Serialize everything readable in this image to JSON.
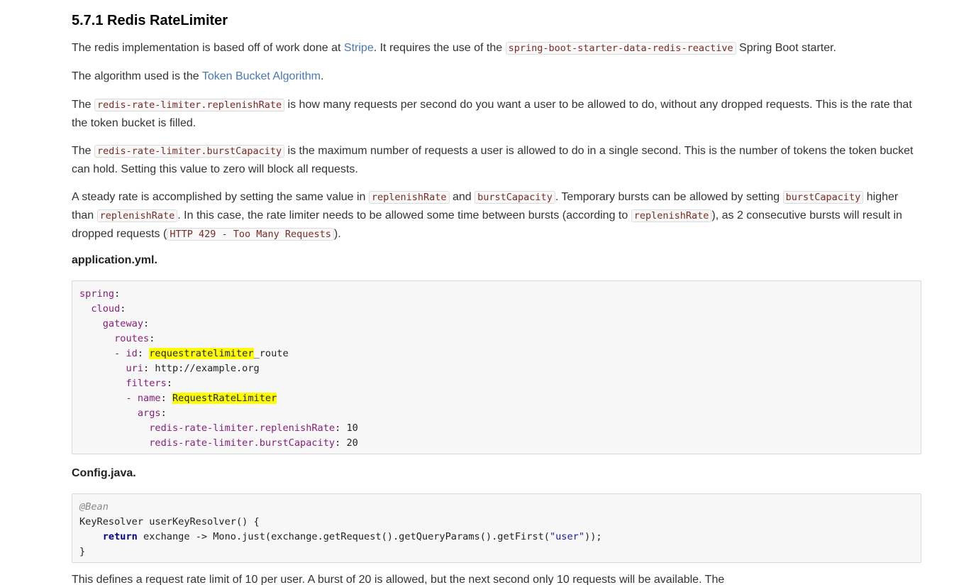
{
  "heading": "5.7.1 Redis RateLimiter",
  "p1": {
    "t1": "The redis implementation is based off of work done at ",
    "link": "Stripe",
    "t2": ". It requires the use of the ",
    "code": "spring-boot-starter-data-redis-reactive",
    "t3": " Spring Boot starter."
  },
  "p2": {
    "t1": "The algorithm used is the ",
    "link": "Token Bucket Algorithm",
    "t2": "."
  },
  "p3": {
    "t1": "The ",
    "code": "redis-rate-limiter.replenishRate",
    "t2": " is how many requests per second do you want a user to be allowed to do, without any dropped requests. This is the rate that the token bucket is filled."
  },
  "p4": {
    "t1": "The ",
    "code": "redis-rate-limiter.burstCapacity",
    "t2": " is the maximum number of requests a user is allowed to do in a single second. This is the number of tokens the token bucket can hold. Setting this value to zero will block all requests."
  },
  "p5": {
    "t1": "A steady rate is accomplished by setting the same value in ",
    "code1": "replenishRate",
    "t2": " and ",
    "code2": "burstCapacity",
    "t3": ". Temporary bursts can be allowed by setting ",
    "code3": "burstCapacity",
    "t4": " higher than ",
    "code4": "replenishRate",
    "t5": ". In this case, the rate limiter needs to be allowed some time between bursts (according to ",
    "code5": "replenishRate",
    "t6": "), as 2 consecutive bursts will result in dropped requests (",
    "code6": "HTTP 429 - Too Many Requests",
    "t7": ")."
  },
  "yaml_title": "application.yml.",
  "yaml": {
    "spring": "spring",
    "cloud": "cloud",
    "gateway": "gateway",
    "routes": "routes",
    "id_key": "id",
    "id_hl": "requestratelimiter",
    "id_rest": "_route",
    "uri_key": "uri",
    "uri_val": "http://example.org",
    "filters": "filters",
    "name_key": "name",
    "name_val": "RequestRateLimiter",
    "args": "args",
    "replenish_key": "redis-rate-limiter.replenishRate",
    "replenish_val": "10",
    "burst_key": "redis-rate-limiter.burstCapacity",
    "burst_val": "20"
  },
  "java_title": "Config.java.",
  "java": {
    "annotation": "@Bean",
    "line2": "KeyResolver userKeyResolver() {",
    "indent": "    ",
    "return_kw": "return",
    "line3_a": " exchange -> Mono.just(exchange.getRequest().getQueryParams().getFirst(",
    "line3_str": "\"user\"",
    "line3_b": "));",
    "line4": "}"
  },
  "p_cut": "This defines a request rate limit of 10 per user. A burst of 20 is allowed, but the next second only 10 requests will be available. The"
}
